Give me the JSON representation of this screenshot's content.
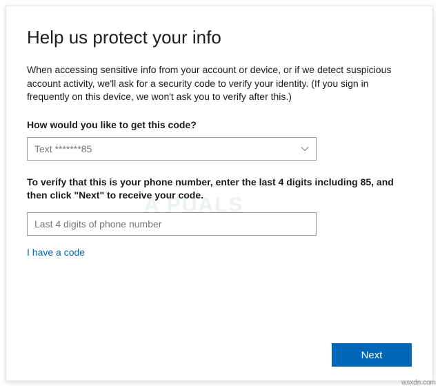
{
  "title": "Help us protect your info",
  "description": "When accessing sensitive info from your account or device, or if we detect suspicious account activity, we'll ask for a security code to verify your identity. (If you sign in frequently on this device, we won't ask you to verify after this.)",
  "method_label": "How would you like to get this code?",
  "method_selected": "Text *******85",
  "verify_instruction": "To verify that this is your phone number, enter the last 4 digits including 85, and then click \"Next\" to receive your code.",
  "digits_placeholder": "Last 4 digits of phone number",
  "digits_value": "",
  "have_code_link": "I have a code",
  "next_label": "Next",
  "watermark": "A  PUALS",
  "attribution": "wsxdn.com"
}
